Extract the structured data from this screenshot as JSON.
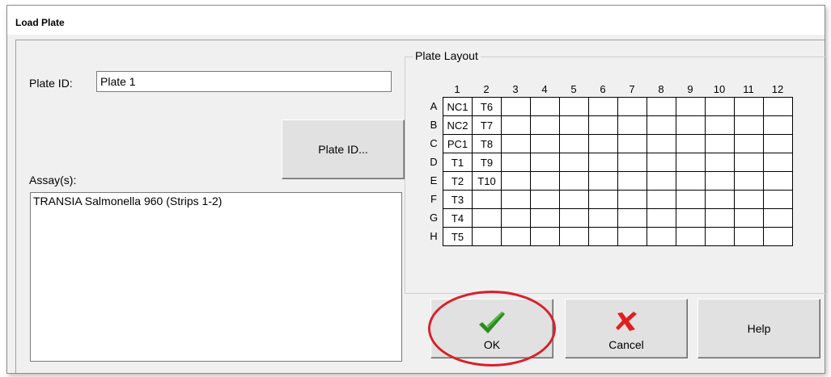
{
  "window": {
    "title": "Load Plate"
  },
  "plate_id": {
    "label": "Plate ID:",
    "value": "Plate 1",
    "button_label": "Plate ID..."
  },
  "assays": {
    "label": "Assay(s):",
    "items": [
      "TRANSIA Salmonella 960 (Strips 1-2)"
    ]
  },
  "plate_layout": {
    "title": "Plate Layout",
    "columns": [
      "1",
      "2",
      "3",
      "4",
      "5",
      "6",
      "7",
      "8",
      "9",
      "10",
      "11",
      "12"
    ],
    "rows": [
      "A",
      "B",
      "C",
      "D",
      "E",
      "F",
      "G",
      "H"
    ],
    "cells": [
      [
        "NC1",
        "T6",
        "",
        "",
        "",
        "",
        "",
        "",
        "",
        "",
        "",
        ""
      ],
      [
        "NC2",
        "T7",
        "",
        "",
        "",
        "",
        "",
        "",
        "",
        "",
        "",
        ""
      ],
      [
        "PC1",
        "T8",
        "",
        "",
        "",
        "",
        "",
        "",
        "",
        "",
        "",
        ""
      ],
      [
        "T1",
        "T9",
        "",
        "",
        "",
        "",
        "",
        "",
        "",
        "",
        "",
        ""
      ],
      [
        "T2",
        "T10",
        "",
        "",
        "",
        "",
        "",
        "",
        "",
        "",
        "",
        ""
      ],
      [
        "T3",
        "",
        "",
        "",
        "",
        "",
        "",
        "",
        "",
        "",
        "",
        ""
      ],
      [
        "T4",
        "",
        "",
        "",
        "",
        "",
        "",
        "",
        "",
        "",
        "",
        ""
      ],
      [
        "T5",
        "",
        "",
        "",
        "",
        "",
        "",
        "",
        "",
        "",
        "",
        ""
      ]
    ]
  },
  "buttons": {
    "ok": "OK",
    "cancel": "Cancel",
    "help": "Help"
  },
  "colors": {
    "ok_check": "#2f8a22",
    "cancel_x": "#e0201e",
    "highlight": "#d9202a"
  }
}
